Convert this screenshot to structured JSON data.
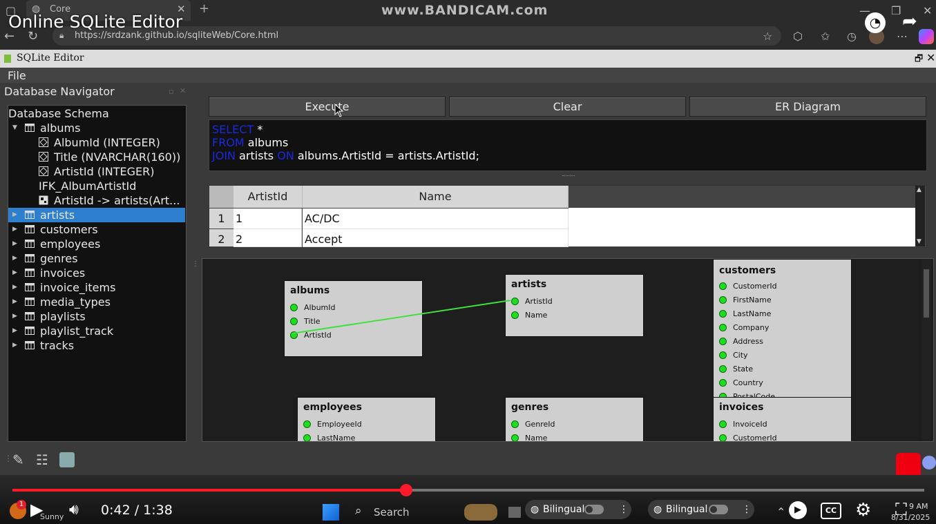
{
  "video": {
    "title": "Online SQLite Editor",
    "watermark": "www.BANDICAM.com",
    "time": "0:42 / 1:38",
    "progress": 0.43
  },
  "browser": {
    "tab_title": "Core",
    "url": "https://srdzank.github.io/sqliteWeb/Core.html"
  },
  "app": {
    "title": "SQLite Editor",
    "menu": [
      "File"
    ],
    "navigator_title": "Database Navigator"
  },
  "tree": {
    "root": "Database Schema",
    "rows": [
      {
        "label": "albums",
        "level": 0,
        "kind": "table",
        "expanded": true
      },
      {
        "label": "AlbumId (INTEGER)",
        "level": 1,
        "kind": "column"
      },
      {
        "label": "Title (NVARCHAR(160))",
        "level": 1,
        "kind": "column"
      },
      {
        "label": "ArtistId (INTEGER)",
        "level": 1,
        "kind": "column"
      },
      {
        "label": "IFK_AlbumArtistId",
        "level": 1,
        "kind": "index"
      },
      {
        "label": "ArtistId -> artists(Art...",
        "level": 1,
        "kind": "fk"
      },
      {
        "label": "artists",
        "level": 0,
        "kind": "table",
        "selected": true
      },
      {
        "label": "customers",
        "level": 0,
        "kind": "table"
      },
      {
        "label": "employees",
        "level": 0,
        "kind": "table"
      },
      {
        "label": "genres",
        "level": 0,
        "kind": "table"
      },
      {
        "label": "invoices",
        "level": 0,
        "kind": "table"
      },
      {
        "label": "invoice_items",
        "level": 0,
        "kind": "table"
      },
      {
        "label": "media_types",
        "level": 0,
        "kind": "table"
      },
      {
        "label": "playlists",
        "level": 0,
        "kind": "table"
      },
      {
        "label": "playlist_track",
        "level": 0,
        "kind": "table"
      },
      {
        "label": "tracks",
        "level": 0,
        "kind": "table"
      }
    ]
  },
  "toolbar": {
    "execute": "Execute",
    "clear": "Clear",
    "er": "ER Diagram"
  },
  "sql": {
    "l1_kw": "SELECT",
    "l1_rest": " *",
    "l2_kw": "FROM",
    "l2_rest": " albums",
    "l3_kw1": "JOIN",
    "l3_mid": " artists ",
    "l3_kw2": "ON",
    "l3_rest": " albums.ArtistId = artists.ArtistId;"
  },
  "results": {
    "columns": [
      "ArtistId",
      "Name"
    ],
    "rows": [
      {
        "num": "1",
        "ArtistId": "1",
        "Name": "AC/DC"
      },
      {
        "num": "2",
        "ArtistId": "2",
        "Name": "Accept"
      }
    ]
  },
  "er": {
    "albums": {
      "title": "albums",
      "fields": [
        "AlbumId",
        "Title",
        "ArtistId"
      ]
    },
    "artists": {
      "title": "artists",
      "fields": [
        "ArtistId",
        "Name"
      ]
    },
    "customers": {
      "title": "customers",
      "fields": [
        "CustomerId",
        "FirstName",
        "LastName",
        "Company",
        "Address",
        "City",
        "State",
        "Country",
        "PostalCode"
      ]
    },
    "employees": {
      "title": "employees",
      "fields": [
        "EmployeeId",
        "LastName"
      ]
    },
    "genres": {
      "title": "genres",
      "fields": [
        "GenreId",
        "Name"
      ]
    },
    "invoices": {
      "title": "invoices",
      "fields": [
        "InvoiceId",
        "CustomerId"
      ]
    }
  },
  "taskbar": {
    "search": "Search",
    "bilingual1": "Bilingual",
    "bilingual2": "Bilingual",
    "clock_time": "9 AM",
    "clock_date": "8/31/2025",
    "weather": "Sunny",
    "notif": "1"
  },
  "colors": {
    "accent": "#2f7fcf",
    "keyword": "#1c28e0",
    "fk_line": "#40e040",
    "progress": "#ff1a2a"
  }
}
